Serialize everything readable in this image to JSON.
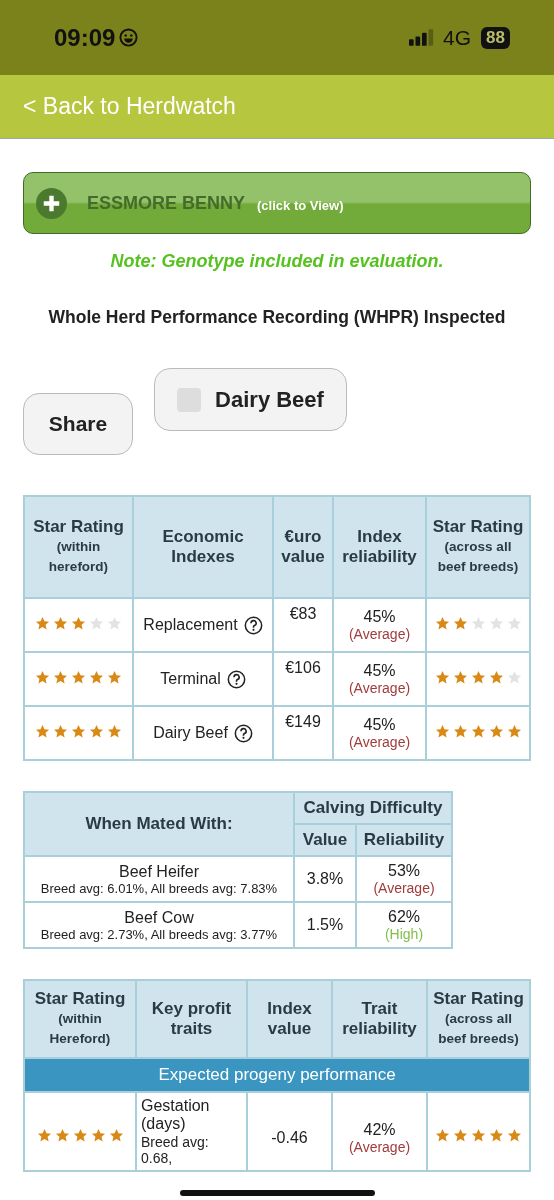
{
  "status_bar": {
    "time": "09:09",
    "network": "4G",
    "battery": "88"
  },
  "nav": {
    "back_link": "< Back to Herdwatch"
  },
  "animal_button": {
    "name": "ESSMORE BENNY",
    "hint": "(click to View)"
  },
  "note": "Note: Genotype included in evaluation.",
  "inspection": "Whole Herd Performance Recording (WHPR) Inspected",
  "share_button": "Share",
  "dairy_beef_toggle": {
    "label": "Dairy Beef",
    "checked": false
  },
  "indexes_table": {
    "columns": [
      {
        "title": "Star Rating",
        "subtitle": "(within hereford)"
      },
      {
        "title": "Economic Indexes"
      },
      {
        "title": "€uro value"
      },
      {
        "title": "Index reliability"
      },
      {
        "title": "Star Rating",
        "subtitle": "(across all beef breeds)"
      }
    ],
    "rows": [
      {
        "within": {
          "stars": 3
        },
        "name": "Replacement",
        "value": "€83",
        "reliability": "45%",
        "rating": {
          "text": "(Average)",
          "color": "#a23b3b"
        },
        "across": {
          "stars": 2
        }
      },
      {
        "within": {
          "stars": 5
        },
        "name": "Terminal",
        "value": "€106",
        "reliability": "45%",
        "rating": {
          "text": "(Average)",
          "color": "#a23b3b"
        },
        "across": {
          "stars": 4
        }
      },
      {
        "within": {
          "stars": 5
        },
        "name": "Dairy Beef",
        "value": "€149",
        "reliability": "45%",
        "rating": {
          "text": "(Average)",
          "color": "#a23b3b"
        },
        "across": {
          "stars": 5
        }
      }
    ]
  },
  "calving_table": {
    "mated_header": "When Mated With:",
    "group_header": "Calving Difficulty",
    "columns": [
      "Value",
      "Reliability"
    ],
    "rows": [
      {
        "name": "Beef Heifer",
        "averages": "Breed avg: 6.01%, All breeds avg: 7.83%",
        "value": "3.8%",
        "reliability": "53%",
        "rating": {
          "text": "(Average)",
          "color": "#a23b3b"
        }
      },
      {
        "name": "Beef Cow",
        "averages": "Breed avg: 2.73%, All breeds avg: 3.77%",
        "value": "1.5%",
        "reliability": "62%",
        "rating": {
          "text": "(High)",
          "color": "#7fbf4a"
        }
      }
    ]
  },
  "traits_table": {
    "columns": [
      {
        "title": "Star Rating",
        "subtitle": "(within Hereford)"
      },
      {
        "title": "Key profit traits"
      },
      {
        "title": "Index value"
      },
      {
        "title": "Trait reliability"
      },
      {
        "title": "Star Rating",
        "subtitle": "(across all beef breeds)"
      }
    ],
    "banner": "Expected progeny performance",
    "rows": [
      {
        "within": {
          "stars": 5
        },
        "name": "Gestation (days)",
        "averages": "Breed avg: 0.68,",
        "value": "-0.46",
        "reliability": "42%",
        "rating": {
          "text": "(Average)",
          "color": "#a23b3b"
        },
        "across": {
          "stars": 5
        }
      }
    ]
  }
}
